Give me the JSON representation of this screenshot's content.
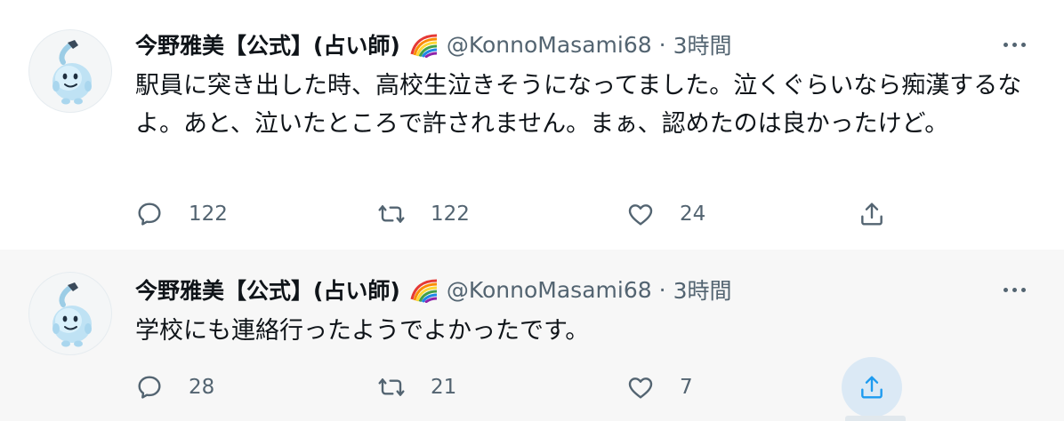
{
  "tweets": [
    {
      "author_name": "今野雅美【公式】(占い師)",
      "handle": "@KonnoMasami68",
      "separator": "·",
      "time": "3時間",
      "text": "駅員に突き出した時、高校生泣きそうになってました。泣くぐらいなら痴漢するなよ。あと、泣いたところで許されません。まぁ、認めたのは良かったけど。",
      "reply_count": "122",
      "retweet_count": "122",
      "like_count": "24",
      "icons": [
        "reply-icon",
        "retweet-icon",
        "like-icon",
        "share-icon",
        "more-icon",
        "rainbow-flag-icon"
      ]
    },
    {
      "author_name": "今野雅美【公式】(占い師)",
      "handle": "@KonnoMasami68",
      "separator": "·",
      "time": "3時間",
      "text": "学校にも連絡行ったようでよかったです。",
      "reply_count": "28",
      "retweet_count": "21",
      "like_count": "7",
      "icons": [
        "reply-icon",
        "retweet-icon",
        "like-icon",
        "share-icon",
        "more-icon",
        "rainbow-flag-icon"
      ]
    }
  ],
  "colors": {
    "text_primary": "#0f1419",
    "text_secondary": "#536471",
    "accent": "#1d9bf0",
    "thread_line": "#cfd9de",
    "hover_background": "#f7f7f7"
  }
}
